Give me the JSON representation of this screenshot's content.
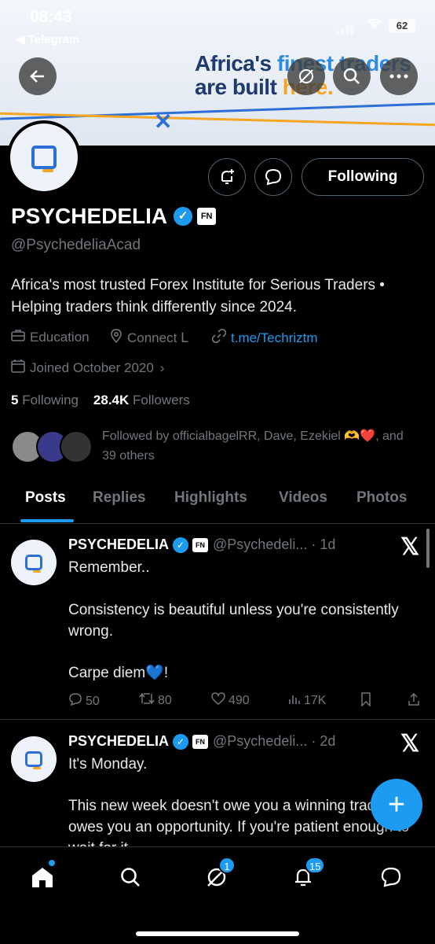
{
  "status_bar": {
    "time": "08:43",
    "back_app": "◀ Telegram",
    "battery": "62"
  },
  "banner": {
    "line1_a": "Africa's ",
    "line1_b": "finest traders",
    "line2_a": "are built ",
    "line2_b": "here."
  },
  "header_buttons": {
    "back_icon": "arrow-left-icon",
    "grok_icon": "slash-circle-icon",
    "search_icon": "search-icon",
    "more_icon": "more-icon"
  },
  "profile": {
    "name": "PSYCHEDELIA",
    "fn_badge": "FN",
    "handle": "@PsychedeliaAcad",
    "bio": "Africa's most trusted Forex Institute for Serious Traders • Helping traders think differently since 2024.",
    "category": "Education",
    "location": "Connect ᒪ",
    "link": "t.me/Techriztm",
    "joined": "Joined October 2020",
    "following_count": "5",
    "following_label": "Following",
    "followers_count": "28.4K",
    "followers_label": "Followers",
    "followed_by": "Followed by officialbagelRR, Dave, Ezekiel 🫶❤️, and 39 others"
  },
  "actions": {
    "following_button": "Following"
  },
  "tabs": [
    "Posts",
    "Replies",
    "Highlights",
    "Videos",
    "Photos"
  ],
  "posts": [
    {
      "name": "PSYCHEDELIA",
      "fn_badge": "FN",
      "handle": "@Psychedeli... · 1d",
      "text_1": "Remember..",
      "text_2": "Consistency is beautiful unless you're consistently wrong.",
      "text_3": "Carpe diem💙!",
      "replies": "50",
      "reposts": "80",
      "likes": "490",
      "views": "17K"
    },
    {
      "name": "PSYCHEDELIA",
      "fn_badge": "FN",
      "handle": "@Psychedeli... · 2d",
      "text_1": "It's Monday.",
      "text_2": "This new week doesn't owe you a winning trade. It owes you an opportunity. If you're patient enough to wait for it."
    }
  ],
  "bottom_nav": {
    "grok_badge": "1",
    "notifications_badge": "15"
  },
  "colors": {
    "accent": "#1d9bf0",
    "background": "#000000",
    "muted": "#71767b"
  }
}
